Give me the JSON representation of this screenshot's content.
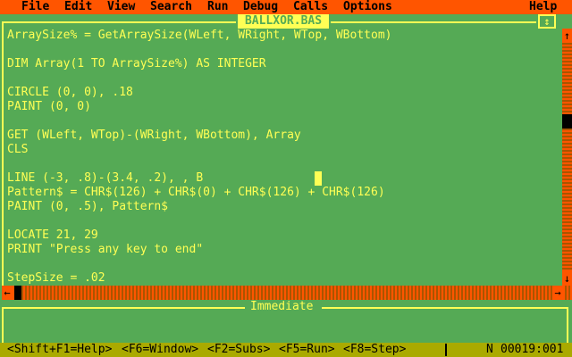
{
  "menubar": {
    "items": [
      "File",
      "Edit",
      "View",
      "Search",
      "Run",
      "Debug",
      "Calls",
      "Options"
    ],
    "help": "Help"
  },
  "editor": {
    "title": "BALLXOR.BAS",
    "lines": [
      "ArraySize% = GetArraySize(WLeft, WRight, WTop, WBottom)",
      "",
      "DIM Array(1 TO ArraySize%) AS INTEGER",
      "",
      "CIRCLE (0, 0), .18",
      "PAINT (0, 0)",
      "",
      "GET (WLeft, WTop)-(WRight, WBottom), Array",
      "CLS",
      "",
      "LINE (-3, .8)-(3.4, .2), , B",
      "Pattern$ = CHR$(126) + CHR$(0) + CHR$(126) + CHR$(126)",
      "PAINT (0, .5), Pattern$",
      "",
      "LOCATE 21, 29",
      "PRINT \"Press any key to end\"",
      "",
      "StepSize = .02"
    ]
  },
  "immediate": {
    "title": "Immediate"
  },
  "statusbar": {
    "items": [
      "<Shift+F1=Help>",
      "<F6=Window>",
      "<F2=Subs>",
      "<F5=Run>",
      "<F8=Step>"
    ],
    "mode": "N",
    "position": "00019:001"
  },
  "colors": {
    "background": "#55aa55",
    "text": "#ffff55",
    "menubar": "#ff5500",
    "statusbar": "#aaaa00"
  },
  "icons": {
    "up_arrow": "↑",
    "down_arrow": "↓",
    "left_arrow": "←",
    "right_arrow": "→",
    "maximize": "↕"
  }
}
